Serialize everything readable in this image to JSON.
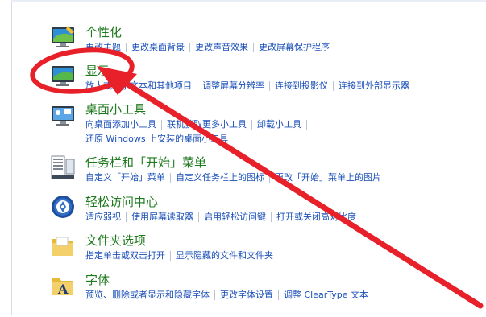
{
  "items": [
    {
      "title": "个性化",
      "icon": "personalization-icon",
      "rows": [
        [
          "更改主题",
          "更改桌面背景",
          "更改声音效果",
          "更改屏幕保护程序"
        ]
      ]
    },
    {
      "title": "显示",
      "icon": "display-icon",
      "rows": [
        [
          "放大或缩小文本和其他项目",
          "调整屏幕分辨率",
          "连接到投影仪",
          "连接到外部显示器"
        ]
      ]
    },
    {
      "title": "桌面小工具",
      "icon": "desktop-gadgets-icon",
      "rows": [
        [
          "向桌面添加小工具",
          "联机获取更多小工具",
          "卸载小工具"
        ],
        [
          "还原 Windows 上安装的桌面小工具"
        ]
      ]
    },
    {
      "title": "任务栏和「开始」菜单",
      "icon": "taskbar-start-menu-icon",
      "rows": [
        [
          "自定义「开始」菜单",
          "自定义任务栏上的图标",
          "更改「开始」菜单上的图片"
        ]
      ]
    },
    {
      "title": "轻松访问中心",
      "icon": "ease-of-access-icon",
      "rows": [
        [
          "适应弱视",
          "使用屏幕读取器",
          "启用轻松访问键",
          "打开或关闭高对比度"
        ]
      ]
    },
    {
      "title": "文件夹选项",
      "icon": "folder-options-icon",
      "rows": [
        [
          "指定单击或双击打开",
          "显示隐藏的文件和文件夹"
        ]
      ]
    },
    {
      "title": "字体",
      "icon": "fonts-icon",
      "rows": [
        [
          "预览、删除或者显示和隐藏字体",
          "更改字体设置",
          "调整 ClearType 文本"
        ]
      ]
    }
  ],
  "colors": {
    "title": "#1e7a1e",
    "link": "#1a4fb8",
    "annotation": "#e8202a"
  }
}
